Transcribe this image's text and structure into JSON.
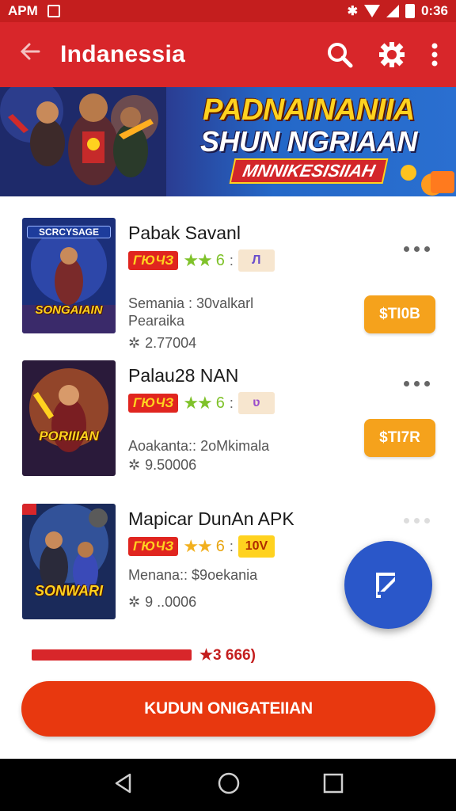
{
  "status_bar": {
    "carrier": "APM",
    "time": "0:36"
  },
  "app_bar": {
    "title": "Indanessia",
    "back_icon": "arrow-left-icon",
    "search_icon": "search-icon",
    "settings_icon": "gear-icon",
    "more_icon": "more-vert-icon"
  },
  "banner": {
    "line1": "PADNAINANIIA",
    "line2": "SHUN NGRIAAN",
    "line3": "MNNIKESISIIAH"
  },
  "items": [
    {
      "thumb_top": "SCRCYSAGE",
      "thumb_label": "SONGAIAIN",
      "name": "Pabak Savanl",
      "tag": "ГЮЧЗ",
      "stars": "★★",
      "rating": "6",
      "colon": ":",
      "badge": "Л",
      "meta_line1": "Semania : 30valkarl",
      "meta_line2": "Pearaika",
      "downloads": "2.77004",
      "price": "$TI0B"
    },
    {
      "thumb_top": "",
      "thumb_label": "PORIIIAN",
      "name": "Palau28 NAN",
      "tag": "ГЮЧЗ",
      "stars": "★★",
      "rating": "6",
      "colon": ":",
      "badge": "ʋ",
      "meta_line1": "Aoakanta:: 2oMkimala",
      "meta_line2": "",
      "downloads": "9.50006",
      "price": "$TI7R"
    },
    {
      "thumb_top": "",
      "thumb_label": "SONWARI",
      "name": "Mapicar DunAn APK",
      "tag": "ГЮЧЗ",
      "stars": "★★",
      "rating": "6",
      "colon": ":",
      "badge": "10V",
      "meta_line1": "Menana:: $9oekania",
      "meta_line2": "",
      "downloads": "9 ..0006",
      "price": ""
    }
  ],
  "progress": {
    "value": 1.0,
    "label": "★3 666)"
  },
  "cta_label": "KUDUN ONIGATEIIAN",
  "nav": {
    "back": "back-triangle-icon",
    "home": "home-circle-icon",
    "recents": "recents-square-icon"
  },
  "colors": {
    "primary": "#d8262a",
    "accent": "#f5a21c",
    "fab": "#2a57c9",
    "cta": "#e8380f"
  }
}
